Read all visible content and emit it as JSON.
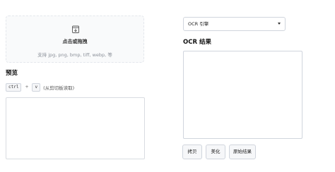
{
  "upload": {
    "icon": "upload-icon",
    "title": "点击或拖拽",
    "hint": "支持 jpg, png, bmp, tiff, webp, 等"
  },
  "preview": {
    "title": "预览",
    "hotkey": {
      "key1": "ctrl",
      "plus": "+",
      "key2": "v",
      "hint": "(从剪切板读取)"
    }
  },
  "engine": {
    "selected": "OCR 引擎"
  },
  "result": {
    "title": "OCR 结果"
  },
  "buttons": {
    "copy": "拷贝",
    "beautify": "美化",
    "raw": "原始结果"
  }
}
